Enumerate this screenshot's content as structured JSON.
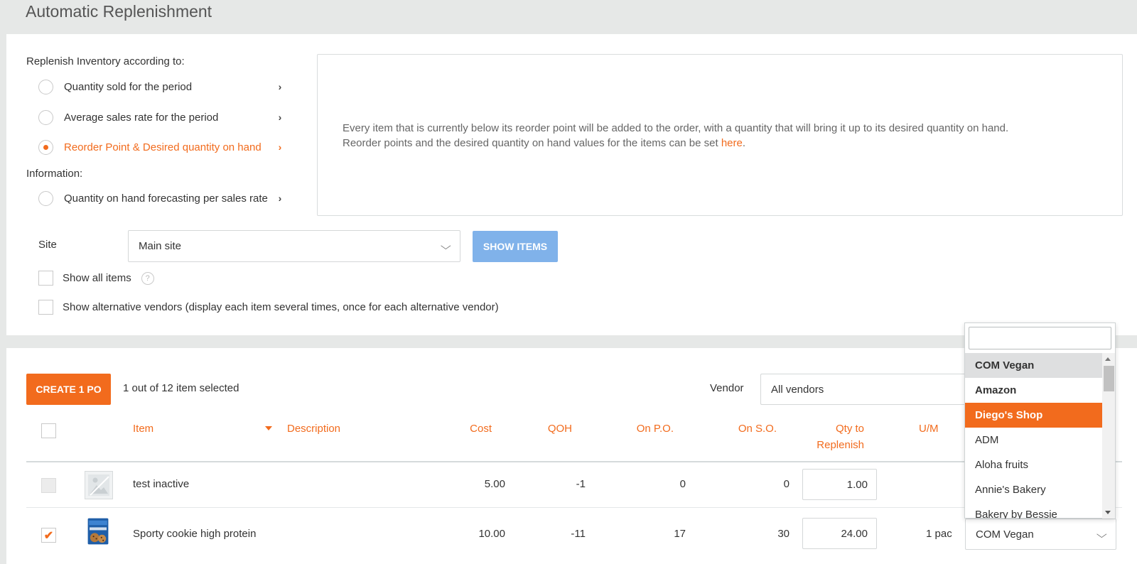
{
  "page": {
    "title": "Automatic Replenishment"
  },
  "replenish": {
    "heading": "Replenish Inventory according to:",
    "options": [
      {
        "label": "Quantity sold for the period",
        "selected": false
      },
      {
        "label": "Average sales rate for the period",
        "selected": false
      },
      {
        "label": "Reorder Point & Desired quantity on hand",
        "selected": true
      }
    ],
    "info_heading": "Information:",
    "info_option": {
      "label": "Quantity on hand forecasting per sales rate",
      "selected": false
    },
    "description_line1": "Every item that is currently below its reorder point will be added to the order, with a quantity that will bring it up to its desired quantity on hand.",
    "description_line2": "Reorder points and the desired quantity on hand values for the items can be set ",
    "description_link": "here",
    "description_end": "."
  },
  "filters": {
    "site_label": "Site",
    "site_value": "Main site",
    "show_items_button": "SHOW ITEMS",
    "show_all_items": "Show all items",
    "help_icon": "?",
    "show_alt_vendors": "Show alternative vendors (display each item several times, once for each alternative vendor)"
  },
  "results": {
    "create_button": "CREATE 1 PO",
    "selection_text": "1 out of 12 item selected",
    "vendor_label": "Vendor",
    "vendor_value": "All vendors"
  },
  "table": {
    "columns": {
      "item": "Item",
      "description": "Description",
      "cost": "Cost",
      "qoh": "QOH",
      "on_po": "On P.O.",
      "on_so": "On S.O.",
      "qty_line1": "Qty to",
      "qty_line2": "Replenish",
      "um": "U/M"
    },
    "rows": [
      {
        "name": "test inactive",
        "cost": "5.00",
        "qoh": "-1",
        "on_po": "0",
        "on_so": "0",
        "qty": "1.00",
        "um": "",
        "vendor": "",
        "checked": false,
        "disabled": true
      },
      {
        "name": "Sporty cookie high protein",
        "cost": "10.00",
        "qoh": "-11",
        "on_po": "17",
        "on_so": "30",
        "qty": "24.00",
        "um": "1 pac",
        "vendor": "COM Vegan",
        "checked": true,
        "disabled": false
      }
    ]
  },
  "vendor_dropdown": {
    "search_value": "",
    "items": [
      "COM Vegan",
      "Amazon",
      "Diego's Shop",
      "ADM",
      "Aloha fruits",
      "Annie's Bakery",
      "Bakery by Bessie"
    ],
    "highlighted": "Diego's Shop"
  },
  "colors": {
    "accent": "#f26b1d",
    "button_disabled_blue": "#80b2ea",
    "background": "#e6e8e7"
  },
  "icons": {
    "chevron": "chevron-right-icon",
    "caret": "chevron-down-icon",
    "check": "checkmark-icon"
  }
}
